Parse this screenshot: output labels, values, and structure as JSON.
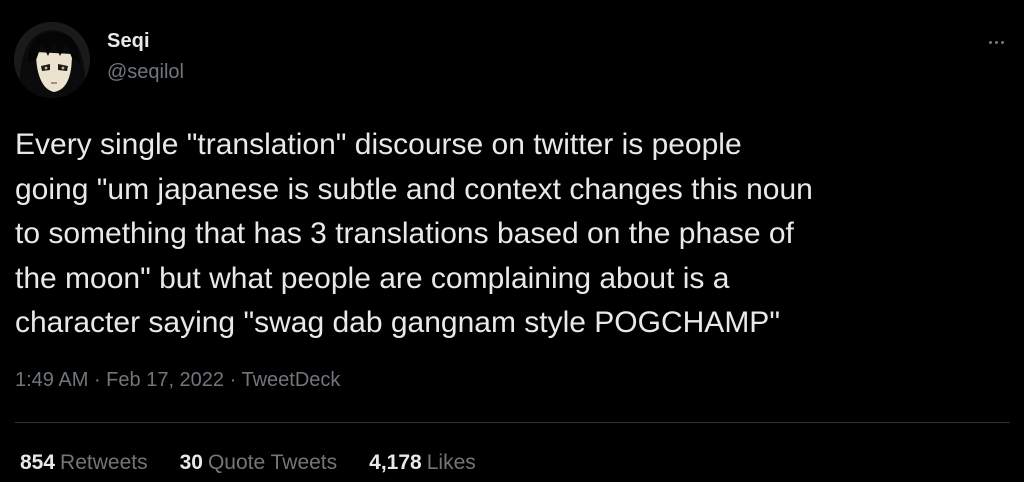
{
  "author": {
    "display_name": "Seqi",
    "handle": "@seqilol",
    "avatar_icon": "anime-girl-avatar"
  },
  "more_icon": "more-horizontal-icon",
  "tweet": {
    "lines": [
      "Every single \"translation\" discourse on twitter is people",
      "going \"um japanese is subtle and context changes this noun",
      "to something that has 3 translations based on the phase of",
      "the moon\" but what people are complaining about is a",
      "character saying \"swag dab gangnam style POGCHAMP\""
    ]
  },
  "meta": {
    "time": "1:49 AM",
    "separator": " · ",
    "date": "Feb 17, 2022",
    "source": "TweetDeck"
  },
  "stats": {
    "retweets": {
      "count": "854",
      "label": "Retweets"
    },
    "quote_tweets": {
      "count": "30",
      "label": "Quote Tweets"
    },
    "likes": {
      "count": "4,178",
      "label": "Likes"
    }
  },
  "colors": {
    "background": "#000000",
    "primary_text": "#e7e9ea",
    "secondary_text": "#71767b",
    "divider": "#2f3336"
  }
}
